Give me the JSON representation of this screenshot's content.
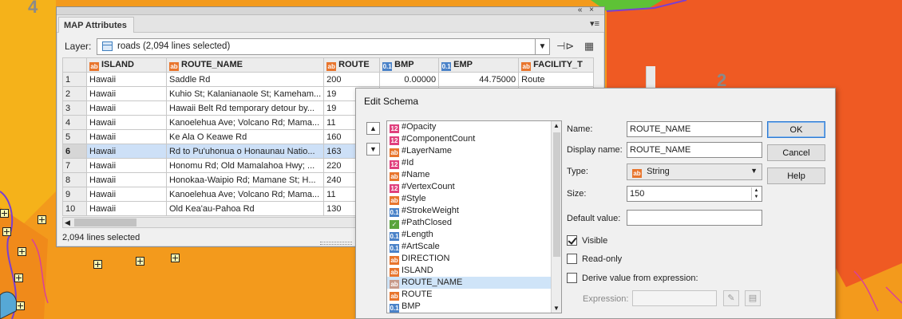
{
  "map": {
    "labels": [
      "4",
      "2"
    ],
    "colors": {
      "orange": "#f39a1c",
      "red_orange": "#ef5a23",
      "yellow": "#f5b21a",
      "green": "#5ec236",
      "purple_road": "#7a3fd1"
    }
  },
  "attributes_panel": {
    "tab_title": "MAP Attributes",
    "layer_label": "Layer:",
    "layer_value": "roads (2,094 lines selected)",
    "columns": [
      {
        "label": "ISLAND",
        "type": "string"
      },
      {
        "label": "ROUTE_NAME",
        "type": "string"
      },
      {
        "label": "ROUTE",
        "type": "string"
      },
      {
        "label": "BMP",
        "type": "double"
      },
      {
        "label": "EMP",
        "type": "double"
      },
      {
        "label": "FACILITY_T",
        "type": "string"
      }
    ],
    "rows": [
      {
        "n": "1",
        "island": "Hawaii",
        "route_name": "Saddle Rd",
        "route": "200",
        "bmp": "0.00000",
        "emp": "44.75000",
        "facility": "Route"
      },
      {
        "n": "2",
        "island": "Hawaii",
        "route_name": "Kuhio St; Kalanianaole St; Kameham...",
        "route": "19",
        "bmp": "",
        "emp": "",
        "facility": ""
      },
      {
        "n": "3",
        "island": "Hawaii",
        "route_name": "Hawaii Belt Rd temporary detour by...",
        "route": "19",
        "bmp": "",
        "emp": "",
        "facility": ""
      },
      {
        "n": "4",
        "island": "Hawaii",
        "route_name": "Kanoelehua Ave; Volcano Rd; Mama...",
        "route": "11",
        "bmp": "",
        "emp": "",
        "facility": ""
      },
      {
        "n": "5",
        "island": "Hawaii",
        "route_name": "Ke Ala O Keawe Rd",
        "route": "160",
        "bmp": "",
        "emp": "",
        "facility": ""
      },
      {
        "n": "6",
        "island": "Hawaii",
        "route_name": "Rd to Pu'uhonua o Honaunau Natio...",
        "route": "163",
        "bmp": "",
        "emp": "",
        "facility": ""
      },
      {
        "n": "7",
        "island": "Hawaii",
        "route_name": "Honomu Rd; Old Mamalahoa Hwy; ...",
        "route": "220",
        "bmp": "",
        "emp": "",
        "facility": ""
      },
      {
        "n": "8",
        "island": "Hawaii",
        "route_name": "Honokaa-Waipio Rd; Mamane St; H...",
        "route": "240",
        "bmp": "",
        "emp": "",
        "facility": ""
      },
      {
        "n": "9",
        "island": "Hawaii",
        "route_name": "Kanoelehua Ave; Volcano Rd; Mama...",
        "route": "11",
        "bmp": "",
        "emp": "",
        "facility": ""
      },
      {
        "n": "10",
        "island": "Hawaii",
        "route_name": "Old Kea'au-Pahoa Rd",
        "route": "130",
        "bmp": "",
        "emp": "",
        "facility": ""
      }
    ],
    "selected_row": "6",
    "status": "2,094 lines selected"
  },
  "edit_schema": {
    "title": "Edit Schema",
    "fields": [
      {
        "label": "#Opacity",
        "type": "int"
      },
      {
        "label": "#ComponentCount",
        "type": "int"
      },
      {
        "label": "#LayerName",
        "type": "string"
      },
      {
        "label": "#Id",
        "type": "int"
      },
      {
        "label": "#Name",
        "type": "string"
      },
      {
        "label": "#VertexCount",
        "type": "int"
      },
      {
        "label": "#Style",
        "type": "string"
      },
      {
        "label": "#StrokeWeight",
        "type": "double"
      },
      {
        "label": "#PathClosed",
        "type": "bool"
      },
      {
        "label": "#Length",
        "type": "double"
      },
      {
        "label": "#ArtScale",
        "type": "double"
      },
      {
        "label": "DIRECTION",
        "type": "string"
      },
      {
        "label": "ISLAND",
        "type": "string"
      },
      {
        "label": "ROUTE_NAME",
        "type": "string"
      },
      {
        "label": "ROUTE",
        "type": "string"
      },
      {
        "label": "BMP",
        "type": "double"
      }
    ],
    "selected_field": "ROUTE_NAME",
    "name_label": "Name:",
    "name_value": "ROUTE_NAME",
    "display_name_label": "Display name:",
    "display_name_value": "ROUTE_NAME",
    "type_label": "Type:",
    "type_value": "String",
    "size_label": "Size:",
    "size_value": "150",
    "default_value_label": "Default value:",
    "default_value": "",
    "visible_label": "Visible",
    "visible_checked": true,
    "readonly_label": "Read-only",
    "readonly_checked": false,
    "derive_label": "Derive value from expression:",
    "derive_checked": false,
    "expression_label": "Expression:",
    "ok_label": "OK",
    "cancel_label": "Cancel",
    "help_label": "Help"
  }
}
